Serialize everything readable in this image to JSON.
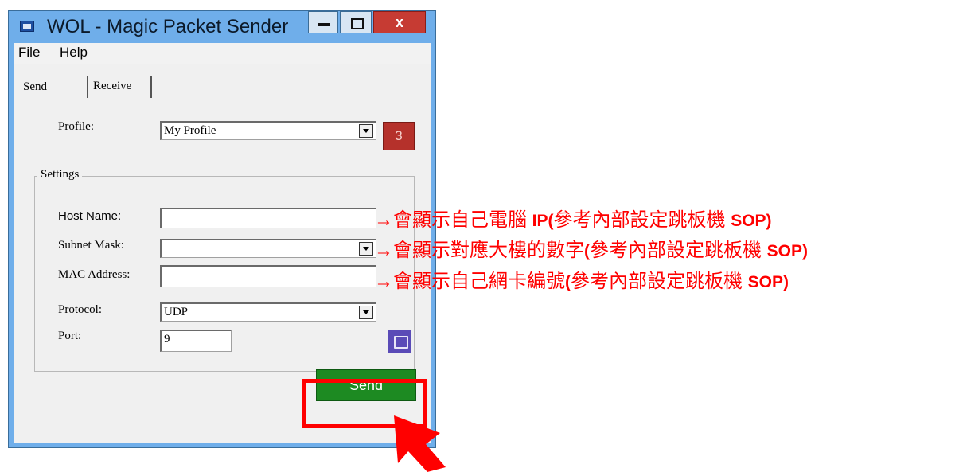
{
  "window": {
    "title": "WOL - Magic Packet Sender",
    "controls": {
      "minimize": "",
      "maximize": "",
      "close": "x"
    }
  },
  "menu": {
    "file": "File",
    "help": "Help"
  },
  "tabs": {
    "send": "Send",
    "receive": "Receive"
  },
  "send_tab": {
    "profile_label": "Profile:",
    "profile_value": "My Profile",
    "profile_button": "3",
    "settings_legend": "Settings",
    "host_name_label": "Host Name:",
    "host_name_value": "",
    "subnet_mask_label": "Subnet Mask:",
    "subnet_mask_value": "",
    "mac_address_label": "MAC Address:",
    "mac_address_value": "",
    "protocol_label": "Protocol:",
    "protocol_value": "UDP",
    "port_label": "Port:",
    "port_value": "9",
    "send_button": "Send"
  },
  "annotations": [
    {
      "zh": "→會顯示自己電腦 ",
      "en": "IP(",
      "zh2": "參考內部設定跳板機 ",
      "en2": "SOP)"
    },
    {
      "zh": "→會顯示對應大樓的數字",
      "en": "(",
      "zh2": "參考內部設定跳板機 ",
      "en2": "SOP)"
    },
    {
      "zh": "→會顯示自己網卡編號",
      "en": "(",
      "zh2": "參考內部設定跳板機 ",
      "en2": "SOP)"
    }
  ],
  "colors": {
    "annotation": "#ff0000",
    "send_button": "#1d8a22",
    "title_bar": "#6faeea",
    "close_button": "#c63b33"
  },
  "icons": [
    "app-icon",
    "minimize-icon",
    "maximize-icon",
    "close-icon",
    "dropdown-arrow-icon",
    "save-icon",
    "pointer-arrow-icon"
  ]
}
